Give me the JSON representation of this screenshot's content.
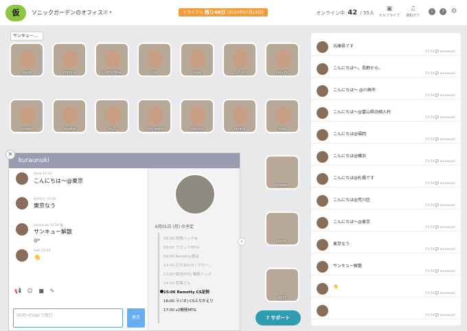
{
  "header": {
    "logo": "仮",
    "office_title": "ソニックガーデンのオフィス",
    "user_dropdown": "池 ▾",
    "trial_label": "トライアル",
    "trial_remaining": "残り48日",
    "trial_until": "(2020年07月19日)",
    "online_label": "オンライン中",
    "online_count": "42",
    "online_total": "/ 55人",
    "btn_camera": "セルフライブ",
    "btn_notify": "通知オフ",
    "icons": [
      "info-icon",
      "help-icon",
      "gear-icon"
    ]
  },
  "tooltip": "サンキュー...",
  "grid": {
    "row1": [
      "ikeda",
      "modera",
      "LudiOrWise",
      "ryu",
      "tetsu",
      "しんちゃん",
      "hosumi"
    ],
    "row2": [
      "kurauki",
      "tanaka",
      "mc3",
      "hiyo_wakki",
      "yukinou",
      "funady",
      "mah"
    ],
    "row3_partial": [
      "sinotaro",
      "tochi",
      "dk77"
    ]
  },
  "room": {
    "title": "kuraunuki",
    "messages": [
      {
        "meta": "tamo  15:54",
        "text": "こんにちは〜@東京"
      },
      {
        "meta": "おかもと  15:54",
        "text": "東京なう"
      },
      {
        "meta": "kuraunuki  15:54 編",
        "text": "サンキュー解散",
        "extra": "@*"
      },
      {
        "meta": "mah  15:54",
        "text": "👋"
      }
    ],
    "input_placeholder": "Shift+Enterで改行",
    "send_label": "発言",
    "schedule_title": "6月01日 (月) の予定",
    "schedule": [
      {
        "time": "08:30",
        "title": "常務ハック★",
        "state": "past"
      },
      {
        "time": "09:00",
        "title": "フロントMTG",
        "state": "past"
      },
      {
        "time": "09:30",
        "title": "Remotty朝会",
        "state": "past"
      },
      {
        "time": "10:00",
        "title": "打ち合わせ) グロー...",
        "state": "past"
      },
      {
        "time": "13:00",
        "title": "経営MTG  業務ハック",
        "state": "past"
      },
      {
        "time": "14:00",
        "title": "営業さん",
        "state": "past"
      },
      {
        "time": "15:00",
        "title": "Remotty CS定例",
        "state": "now"
      },
      {
        "time": "16:00",
        "title": "ラジオ) CSふりかえり",
        "state": "next"
      },
      {
        "time": "17:00",
        "title": "v2開発MTG",
        "state": "next"
      }
    ]
  },
  "support_label": "? サポート",
  "chat": [
    {
      "text": "兵庫県です",
      "meta": "15:54 💬 kuraunuki"
    },
    {
      "text": "こんにちは〜。長野から。",
      "meta": "15:54 💬 kuraunuki"
    },
    {
      "text": "こんにちは〜 @川崎市",
      "meta": "15:54 💬 kuraunuki"
    },
    {
      "text": "こんにちは〜@富山県旧細入村",
      "meta": "15:54 💬 kuraunuki"
    },
    {
      "text": "こんにちは@福岡",
      "meta": "15:54 💬 kuraunuki"
    },
    {
      "text": "こんにちは@横浜",
      "meta": "15:54 💬 kuraunuki"
    },
    {
      "text": "こんにちは@札幌です",
      "meta": "15:54 💬 kuraunuki"
    },
    {
      "text": "こんにちは@荒川区",
      "meta": "15:54 💬 kuraunuki"
    },
    {
      "text": "こんにちは〜@東京",
      "meta": "15:54 💬 kuraunuki"
    },
    {
      "text": "東京なう",
      "meta": "15:54 💬 kuraunuki"
    },
    {
      "text": "サンキュー解散",
      "meta": "15:54 💬 kuraunuki"
    },
    {
      "text": "👋",
      "meta": "15:54 💬 kuraunuki"
    },
    {
      "text": "",
      "meta": "15:54 💬 kuraunuki"
    }
  ]
}
